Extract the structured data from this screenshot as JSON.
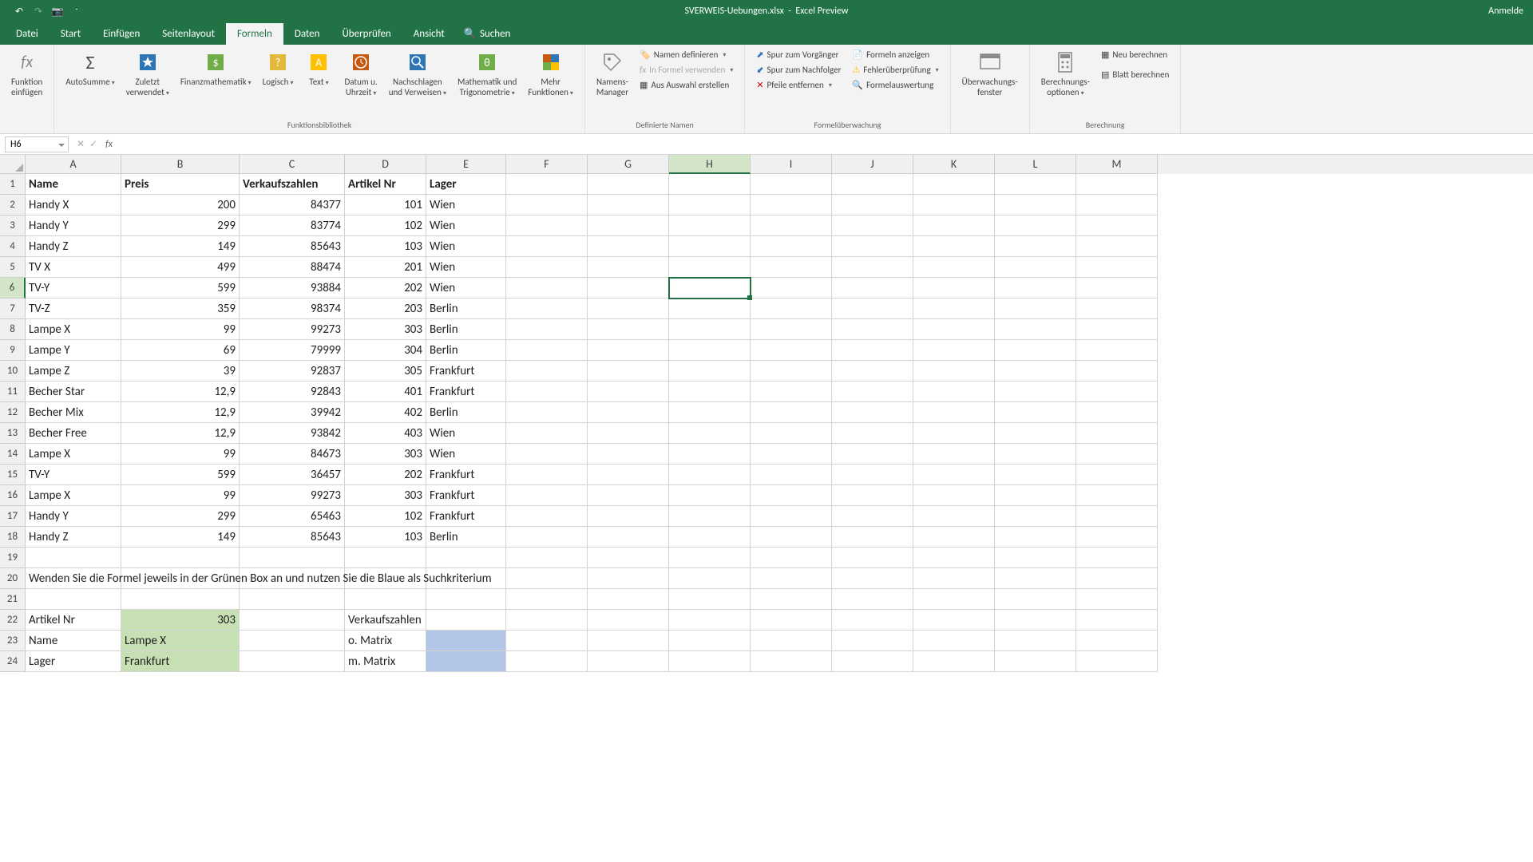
{
  "title": {
    "filename": "SVERWEIS-Uebungen.xlsx",
    "app": "Excel Preview",
    "login": "Anmelde"
  },
  "tabs": [
    "Datei",
    "Start",
    "Einfügen",
    "Seitenlayout",
    "Formeln",
    "Daten",
    "Überprüfen",
    "Ansicht"
  ],
  "search_placeholder": "Suchen",
  "ribbon": {
    "insert_fn": "Funktion\neinfügen",
    "autosum": "AutoSumme",
    "recent": "Zuletzt\nverwendet",
    "financial": "Finanzmathematik",
    "logical": "Logisch",
    "text": "Text",
    "datetime": "Datum u.\nUhrzeit",
    "lookup": "Nachschlagen\nund Verweisen",
    "math": "Mathematik und\nTrigonometrie",
    "more": "Mehr\nFunktionen",
    "group_lib": "Funktionsbibliothek",
    "name_mgr": "Namens-\nManager",
    "define_name": "Namen definieren",
    "use_formula": "In Formel verwenden",
    "from_sel": "Aus Auswahl erstellen",
    "group_names": "Definierte Namen",
    "trace_prec": "Spur zum Vorgänger",
    "trace_dep": "Spur zum Nachfolger",
    "remove_arrows": "Pfeile entfernen",
    "show_formulas": "Formeln anzeigen",
    "error_check": "Fehlerüberprüfung",
    "eval_formula": "Formelauswertung",
    "group_audit": "Formelüberwachung",
    "watch": "Überwachungs-\nfenster",
    "calc_opts": "Berechnungs-\noptionen",
    "calc_now": "Neu berechnen",
    "calc_sheet": "Blatt berechnen",
    "group_calc": "Berechnung"
  },
  "namebox": "H6",
  "columns": [
    "A",
    "B",
    "C",
    "D",
    "E",
    "F",
    "G",
    "H",
    "I",
    "J",
    "K",
    "L",
    "M"
  ],
  "headers": {
    "A": "Name",
    "B": "Preis",
    "C": "Verkaufszahlen",
    "D": "Artikel Nr",
    "E": "Lager"
  },
  "rows": [
    {
      "A": "Handy X",
      "B": "200",
      "C": "84377",
      "D": "101",
      "E": "Wien"
    },
    {
      "A": "Handy Y",
      "B": "299",
      "C": "83774",
      "D": "102",
      "E": "Wien"
    },
    {
      "A": "Handy Z",
      "B": "149",
      "C": "85643",
      "D": "103",
      "E": "Wien"
    },
    {
      "A": "TV X",
      "B": "499",
      "C": "88474",
      "D": "201",
      "E": "Wien"
    },
    {
      "A": "TV-Y",
      "B": "599",
      "C": "93884",
      "D": "202",
      "E": "Wien"
    },
    {
      "A": "TV-Z",
      "B": "359",
      "C": "98374",
      "D": "203",
      "E": "Berlin"
    },
    {
      "A": "Lampe X",
      "B": "99",
      "C": "99273",
      "D": "303",
      "E": "Berlin"
    },
    {
      "A": "Lampe Y",
      "B": "69",
      "C": "79999",
      "D": "304",
      "E": "Berlin"
    },
    {
      "A": "Lampe Z",
      "B": "39",
      "C": "92837",
      "D": "305",
      "E": "Frankfurt"
    },
    {
      "A": "Becher Star",
      "B": "12,9",
      "C": "92843",
      "D": "401",
      "E": "Frankfurt"
    },
    {
      "A": "Becher Mix",
      "B": "12,9",
      "C": "39942",
      "D": "402",
      "E": "Berlin"
    },
    {
      "A": "Becher Free",
      "B": "12,9",
      "C": "93842",
      "D": "403",
      "E": "Wien"
    },
    {
      "A": "Lampe X",
      "B": "99",
      "C": "84673",
      "D": "303",
      "E": "Wien"
    },
    {
      "A": "TV-Y",
      "B": "599",
      "C": "36457",
      "D": "202",
      "E": "Frankfurt"
    },
    {
      "A": "Lampe X",
      "B": "99",
      "C": "99273",
      "D": "303",
      "E": "Frankfurt"
    },
    {
      "A": "Handy Y",
      "B": "299",
      "C": "65463",
      "D": "102",
      "E": "Frankfurt"
    },
    {
      "A": "Handy Z",
      "B": "149",
      "C": "85643",
      "D": "103",
      "E": "Berlin"
    }
  ],
  "row20": "Wenden Sie die Formel jeweils in der Grünen Box an und nutzen Sie die Blaue als Suchkriterium",
  "r22": {
    "A": "Artikel Nr",
    "B": "303",
    "D": "Verkaufszahlen"
  },
  "r23": {
    "A": "Name",
    "B": "Lampe X",
    "D": "o. Matrix"
  },
  "r24": {
    "A": "Lager",
    "B": "Frankfurt",
    "D": "m. Matrix"
  }
}
